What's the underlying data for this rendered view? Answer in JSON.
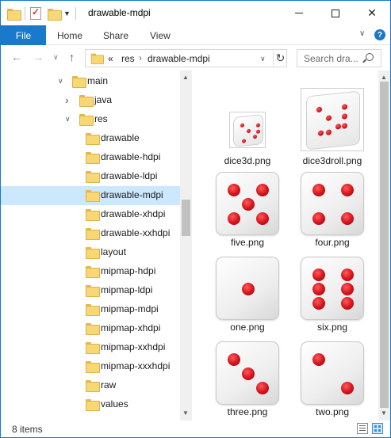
{
  "window": {
    "title": "drawable-mdpi",
    "colors": {
      "accent": "#1979ca",
      "selection": "#cce8ff",
      "folder": "#f8d775",
      "pip": "#d3121b"
    }
  },
  "ribbon": {
    "file_tab": "File",
    "tabs": [
      "Home",
      "Share",
      "View"
    ]
  },
  "address_bar": {
    "overflow_marker": "«",
    "path": [
      "res",
      "drawable-mdpi"
    ],
    "search_placeholder": "Search dra..."
  },
  "nav_tree": {
    "items": [
      {
        "label": "main",
        "expander": "expanded",
        "selected": false
      },
      {
        "label": "java",
        "expander": "collapsed",
        "selected": false
      },
      {
        "label": "res",
        "expander": "expanded",
        "selected": false
      },
      {
        "label": "drawable",
        "expander": "none",
        "selected": false
      },
      {
        "label": "drawable-hdpi",
        "expander": "none",
        "selected": false
      },
      {
        "label": "drawable-ldpi",
        "expander": "none",
        "selected": false
      },
      {
        "label": "drawable-mdpi",
        "expander": "none",
        "selected": true
      },
      {
        "label": "drawable-xhdpi",
        "expander": "none",
        "selected": false
      },
      {
        "label": "drawable-xxhdpi",
        "expander": "none",
        "selected": false
      },
      {
        "label": "layout",
        "expander": "none",
        "selected": false
      },
      {
        "label": "mipmap-hdpi",
        "expander": "none",
        "selected": false
      },
      {
        "label": "mipmap-ldpi",
        "expander": "none",
        "selected": false
      },
      {
        "label": "mipmap-mdpi",
        "expander": "none",
        "selected": false
      },
      {
        "label": "mipmap-xhdpi",
        "expander": "none",
        "selected": false
      },
      {
        "label": "mipmap-xxhdpi",
        "expander": "none",
        "selected": false
      },
      {
        "label": "mipmap-xxxhdpi",
        "expander": "none",
        "selected": false
      },
      {
        "label": "raw",
        "expander": "none",
        "selected": false
      },
      {
        "label": "values",
        "expander": "none",
        "selected": false
      }
    ]
  },
  "files": [
    {
      "name": "dice3d.png",
      "kind": "die-3d-small"
    },
    {
      "name": "dice3droll.png",
      "kind": "die-3d-large"
    },
    {
      "name": "five.png",
      "kind": "die-face",
      "pips": 5
    },
    {
      "name": "four.png",
      "kind": "die-face",
      "pips": 4
    },
    {
      "name": "one.png",
      "kind": "die-face",
      "pips": 1
    },
    {
      "name": "six.png",
      "kind": "die-face",
      "pips": 6
    },
    {
      "name": "three.png",
      "kind": "die-face",
      "pips": 3
    },
    {
      "name": "two.png",
      "kind": "die-face",
      "pips": 2
    }
  ],
  "status": {
    "item_count": "8 items"
  }
}
